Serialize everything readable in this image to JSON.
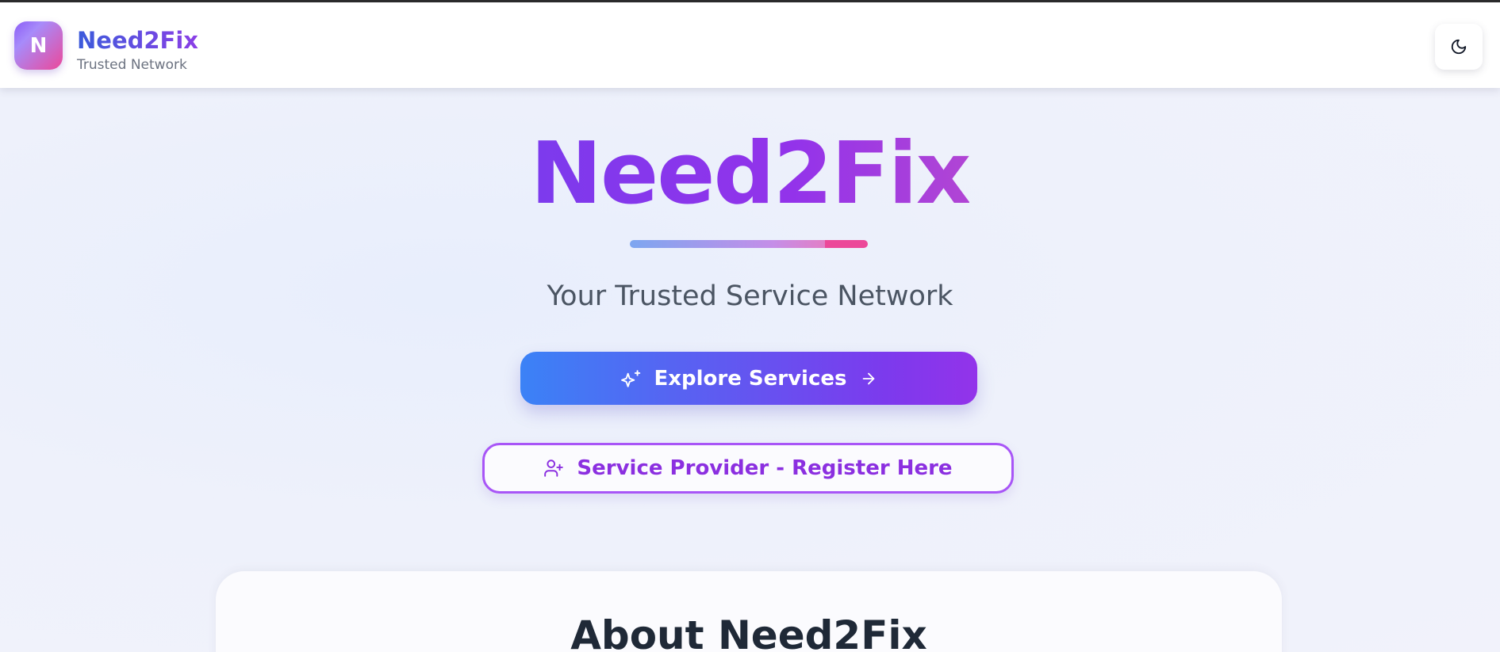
{
  "header": {
    "logo_letter": "N",
    "brand_name": "Need2Fix",
    "tagline": "Trusted Network",
    "theme_toggle_icon": "moon-icon"
  },
  "hero": {
    "title": "Need2Fix",
    "subtitle": "Your Trusted Service Network",
    "explore_button": {
      "label": "Explore Services",
      "leading_icon": "sparkles-icon",
      "trailing_icon": "arrow-right-icon"
    },
    "register_button": {
      "label": "Service Provider - Register Here",
      "leading_icon": "user-plus-icon"
    }
  },
  "about": {
    "title": "About Need2Fix"
  },
  "colors": {
    "brand_purple": "#7c3aed",
    "brand_blue": "#3b82f6",
    "brand_pink": "#ec4899"
  }
}
